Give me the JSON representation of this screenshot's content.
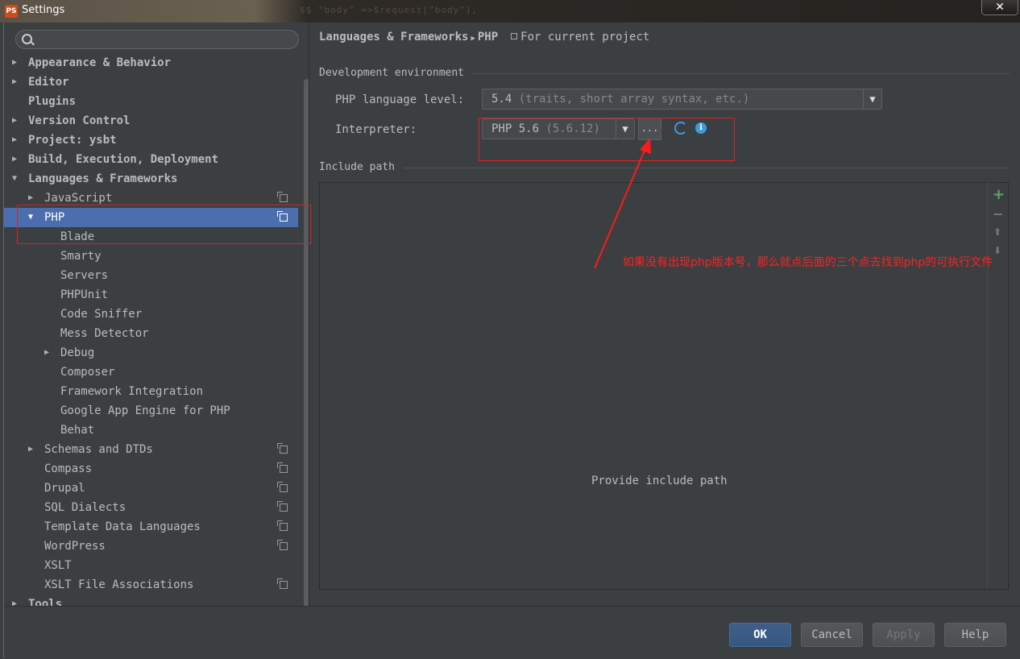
{
  "window": {
    "title": "Settings",
    "close_label": "✕",
    "background_code": "$$      \"body\"      =>$request[\"body\"],"
  },
  "search": {
    "value": ""
  },
  "tree": [
    {
      "label": "Appearance & Behavior",
      "arrow": "▶",
      "bold": true,
      "level": 0
    },
    {
      "label": "Editor",
      "arrow": "▶",
      "bold": true,
      "level": 0
    },
    {
      "label": "Plugins",
      "arrow": "",
      "bold": true,
      "level": 0
    },
    {
      "label": "Version Control",
      "arrow": "▶",
      "bold": true,
      "level": 0
    },
    {
      "label": "Project: ysbt",
      "arrow": "▶",
      "bold": true,
      "level": 0
    },
    {
      "label": "Build, Execution, Deployment",
      "arrow": "▶",
      "bold": true,
      "level": 0
    },
    {
      "label": "Languages & Frameworks",
      "arrow": "▼",
      "bold": true,
      "level": 0
    },
    {
      "label": "JavaScript",
      "arrow": "▶",
      "level": 1,
      "project": true
    },
    {
      "label": "PHP",
      "arrow": "▼",
      "level": 1,
      "project": true,
      "selected": true
    },
    {
      "label": "Blade",
      "arrow": "",
      "level": 2
    },
    {
      "label": "Smarty",
      "arrow": "",
      "level": 2
    },
    {
      "label": "Servers",
      "arrow": "",
      "level": 2
    },
    {
      "label": "PHPUnit",
      "arrow": "",
      "level": 2
    },
    {
      "label": "Code Sniffer",
      "arrow": "",
      "level": 2
    },
    {
      "label": "Mess Detector",
      "arrow": "",
      "level": 2
    },
    {
      "label": "Debug",
      "arrow": "▶",
      "level": 2
    },
    {
      "label": "Composer",
      "arrow": "",
      "level": 2
    },
    {
      "label": "Framework Integration",
      "arrow": "",
      "level": 2
    },
    {
      "label": "Google App Engine for PHP",
      "arrow": "",
      "level": 2
    },
    {
      "label": "Behat",
      "arrow": "",
      "level": 2
    },
    {
      "label": "Schemas and DTDs",
      "arrow": "▶",
      "level": 1,
      "project": true
    },
    {
      "label": "Compass",
      "arrow": "",
      "level": 1,
      "project": true
    },
    {
      "label": "Drupal",
      "arrow": "",
      "level": 1,
      "project": true
    },
    {
      "label": "SQL Dialects",
      "arrow": "",
      "level": 1,
      "project": true
    },
    {
      "label": "Template Data Languages",
      "arrow": "",
      "level": 1,
      "project": true
    },
    {
      "label": "WordPress",
      "arrow": "",
      "level": 1,
      "project": true
    },
    {
      "label": "XSLT",
      "arrow": "",
      "level": 1
    },
    {
      "label": "XSLT File Associations",
      "arrow": "",
      "level": 1,
      "project": true
    },
    {
      "label": "Tools",
      "arrow": "▶",
      "bold": true,
      "level": 0
    }
  ],
  "breadcrumb": {
    "part1": "Languages & Frameworks",
    "separator": "▶",
    "part2": "PHP",
    "scope": "For current project"
  },
  "dev_env": {
    "section_title": "Development environment",
    "language_level_label": "PHP language level:",
    "language_level_value": "5.4",
    "language_level_desc": "(traits, short array syntax, etc.)",
    "interpreter_label": "Interpreter:",
    "interpreter_value": "PHP 5.6",
    "interpreter_version": "(5.6.12)",
    "dots_label": "...",
    "info_label": "i"
  },
  "include": {
    "section_title": "Include path",
    "empty_text": "Provide include path",
    "add": "+",
    "remove": "−",
    "up": "⬆",
    "down": "⬇"
  },
  "annotation": {
    "text": "如果没有出现php版本号，那么就点后面的三个点去找到php的可执行文件",
    "color": "#ff2020"
  },
  "footer": {
    "ok": "OK",
    "cancel": "Cancel",
    "apply": "Apply",
    "help": "Help"
  },
  "colors": {
    "selection": "#4b6eaf",
    "background": "#3c3f41",
    "accent_blue": "#3d9be0",
    "add_green": "#59a869"
  }
}
